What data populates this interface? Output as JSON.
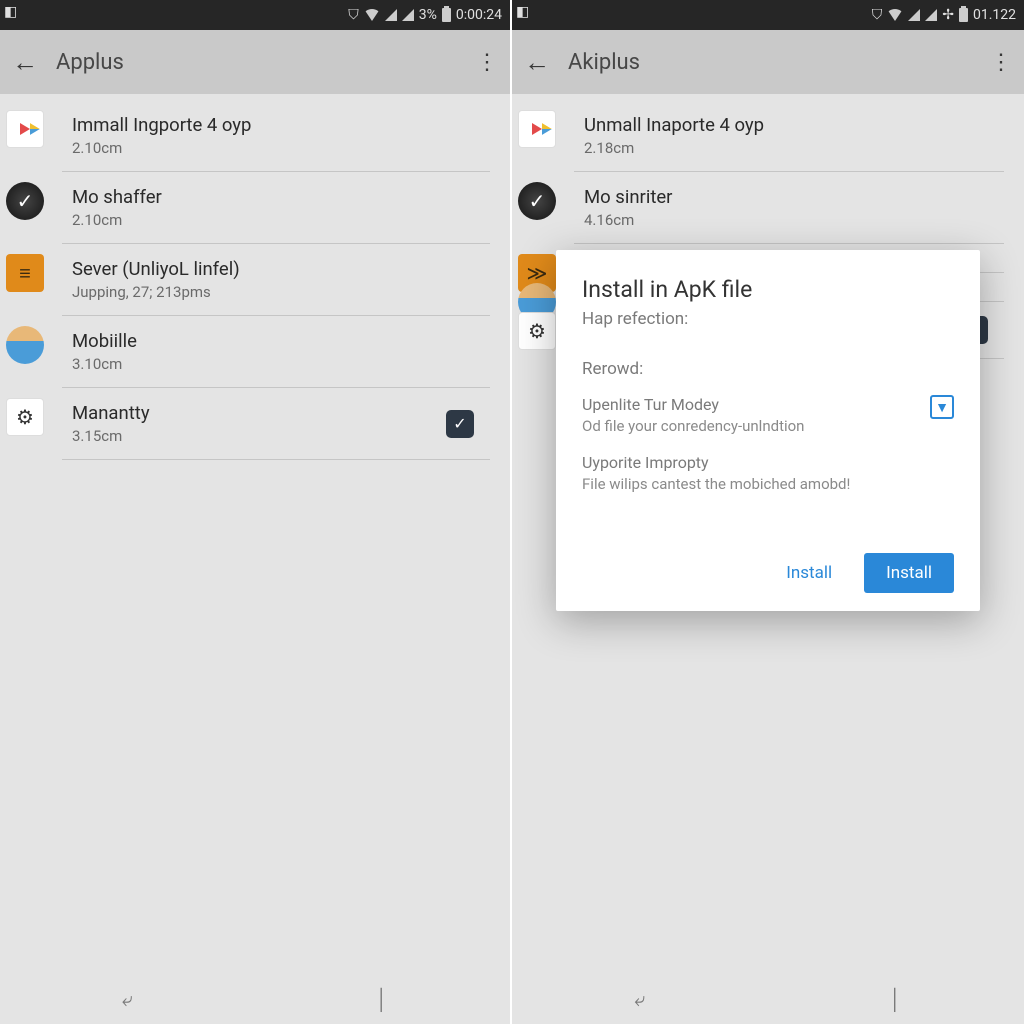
{
  "left": {
    "status": {
      "battery": "3%",
      "time": "0:00:24"
    },
    "title": "Applus",
    "items": [
      {
        "title": "Immall Ingporte 4 oyp",
        "sub": "2.10cm",
        "icon": "play"
      },
      {
        "title": "Mo shaffer",
        "sub": "2.10cm",
        "icon": "dark"
      },
      {
        "title": "Sever (UnliyoL linfel)",
        "sub": "Jupping, 27; 213pms",
        "icon": "orange"
      },
      {
        "title": "Mobiille",
        "sub": "3.10cm",
        "icon": "globe"
      },
      {
        "title": "Manantty",
        "sub": "3.15cm",
        "icon": "gear",
        "checked": true
      }
    ]
  },
  "right": {
    "status": {
      "time": "01.122"
    },
    "title": "Akiplus",
    "items": [
      {
        "title": "Unmall Inaporte 4 oyp",
        "sub": "2.18cm",
        "icon": "play"
      },
      {
        "title": "Mo sinriter",
        "sub": "4.16cm",
        "icon": "dark"
      },
      {
        "title": "",
        "sub": "",
        "icon": "orange"
      },
      {
        "title": "",
        "sub": "",
        "icon": "globe"
      },
      {
        "title": "",
        "sub": "",
        "icon": "gear",
        "checked": true
      }
    ],
    "dialog": {
      "title": "Install in ApK file",
      "subtitle": "Hap refection:",
      "section_label": "Rerowd:",
      "row1": {
        "title": "Upenlite Tur Modey",
        "desc": "Od file your conredency-unlndtion",
        "checked": true
      },
      "row2": {
        "title": "Uyporite Impropty",
        "desc": "File wilips cantest the mobiched amobd!"
      },
      "action_flat": "Install",
      "action_raised": "Install"
    }
  }
}
